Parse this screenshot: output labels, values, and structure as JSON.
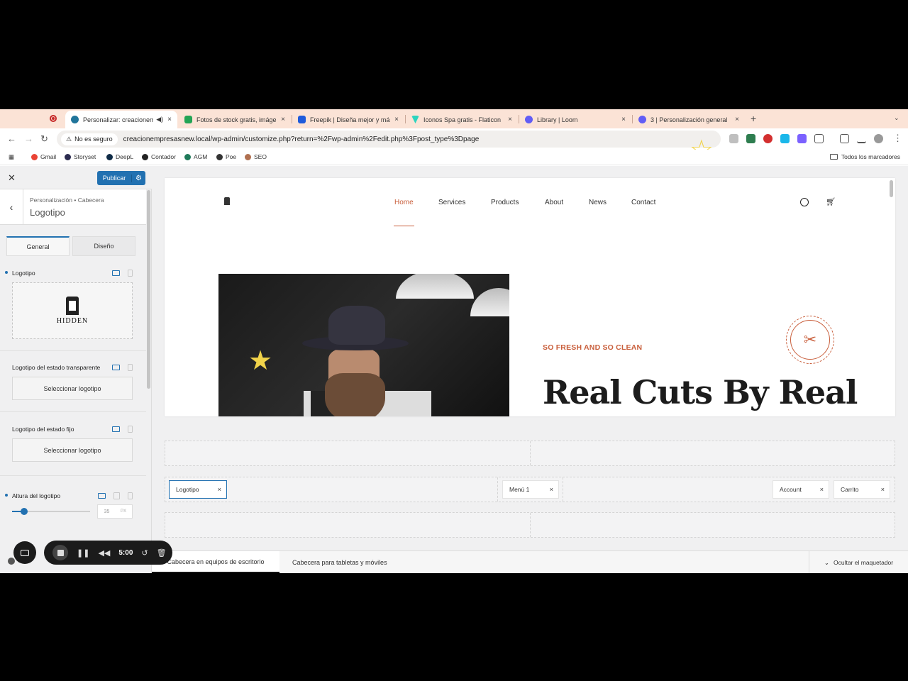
{
  "browser": {
    "tabs": [
      {
        "title": "Personalizar: creacionem",
        "favicon_color": "#21759b",
        "active": true
      },
      {
        "title": "Fotos de stock gratis, imágen",
        "favicon_color": "#23a455",
        "active": false
      },
      {
        "title": "Freepik | Diseña mejor y más",
        "favicon_color": "#1f5bdb",
        "active": false
      },
      {
        "title": "Iconos Spa gratis - Flaticon",
        "favicon_color": "#2dd4bf",
        "active": false
      },
      {
        "title": "Library | Loom",
        "favicon_color": "#625df5",
        "active": false
      },
      {
        "title": "3 | Personalización general",
        "favicon_color": "#625df5",
        "active": false
      }
    ],
    "security_label": "No es seguro",
    "url": "creacionempresasnew.local/wp-admin/customize.php?return=%2Fwp-admin%2Fedit.php%3Fpost_type%3Dpage",
    "bookmarks": [
      {
        "label": "Gmail",
        "color": "#ea4335"
      },
      {
        "label": "Storyset",
        "color": "#2b2b4f"
      },
      {
        "label": "DeepL",
        "color": "#0f2b46"
      },
      {
        "label": "Contador",
        "color": "#222222"
      },
      {
        "label": "AGM",
        "color": "#1f7a5a"
      },
      {
        "label": "Poe",
        "color": "#333333"
      },
      {
        "label": "SEO",
        "color": "#b07050"
      }
    ],
    "all_bookmarks": "Todos los marcadores"
  },
  "customizer": {
    "publish_label": "Publicar",
    "breadcrumb": "Personalización • Cabecera",
    "section_title": "Logotipo",
    "tabs": [
      "General",
      "Diseño"
    ],
    "fields": {
      "logo_label": "Logotipo",
      "logo_text": "HIDDEN",
      "transparent_label": "Logotipo del estado transparente",
      "sticky_label": "Logotipo del estado fijo",
      "select_logo": "Seleccionar logotipo",
      "height_label": "Altura del logotipo",
      "height_value": "35",
      "height_unit": "PX",
      "height_fraction": 0.15
    }
  },
  "preview": {
    "menu": [
      "Home",
      "Services",
      "Products",
      "About",
      "News",
      "Contact"
    ],
    "eyebrow": "SO FRESH AND SO CLEAN",
    "title": "Real Cuts By Real",
    "accent": "#c95f3c"
  },
  "builder": {
    "chips": [
      "Logotipo",
      "Menú 1",
      "Account",
      "Carrito"
    ],
    "bottom_tabs": [
      "Cabecera en equipos de escritorio",
      "Cabecera para tabletas y móviles"
    ],
    "hide_label": "Ocultar el maquetador"
  },
  "loom": {
    "timer": "5:00"
  }
}
